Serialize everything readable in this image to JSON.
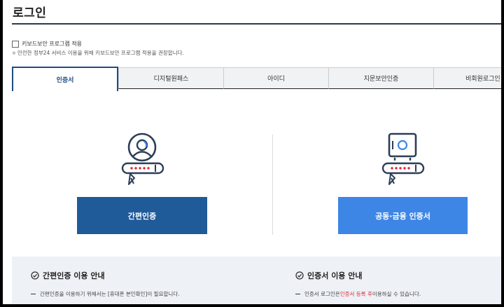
{
  "page": {
    "title": "로그인"
  },
  "options": {
    "keyboard_security_label": "키보드보안 프로그램 적용",
    "keyboard_security_notice": "안전한 정부24 서비스 이용을 위해 키보드보안 프로그램 적용을 권장합니다."
  },
  "tabs": [
    {
      "label": "인증서",
      "active": true
    },
    {
      "label": "디지털원패스",
      "active": false
    },
    {
      "label": "아이디",
      "active": false
    },
    {
      "label": "지문보안인증",
      "active": false
    },
    {
      "label": "비회원로그인",
      "active": false
    }
  ],
  "login": {
    "simple_button": "간편인증",
    "cert_button": "공동·금융 인증서"
  },
  "guide": {
    "simple": {
      "title": "간편인증 이용 안내",
      "line": "간편인증을 이용하기 위해서는 [휴대폰 본인확인]이 필요합니다."
    },
    "cert": {
      "title": "인증서 이용 안내",
      "line_pre": "인증서 로그인은 ",
      "line_highlight": "인증서 등록 후",
      "line_post": " 이용하실 수 있습니다."
    }
  },
  "colors": {
    "primary_dark": "#1f5a99",
    "primary_light": "#3d86e6",
    "accent_red": "#e0293a",
    "tab_active": "#1f4c84"
  },
  "icons": [
    "user-profile-icon",
    "password-bar-icon",
    "cursor-icon",
    "safe-icon",
    "check-circle-icon"
  ]
}
